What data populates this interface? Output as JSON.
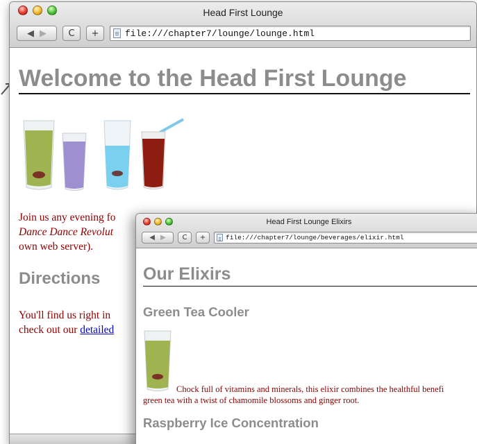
{
  "main_window": {
    "title": "Head First Lounge",
    "url": "file:///chapter7/lounge/lounge.html",
    "buttons": {
      "back": "◀",
      "forward": "▶",
      "reload": "C",
      "add": "+"
    },
    "heading": "Welcome to the Head First Lounge",
    "intro_text_1": "Join us any evening fo",
    "intro_text_2": "Dance Dance Revolut",
    "intro_text_3": "own web server).",
    "directions_heading": "Directions",
    "directions_text_1": "You'll find us right in",
    "directions_text_2": "check out our ",
    "directions_link": "detailed"
  },
  "elixir_window": {
    "title": "Head First Lounge Elixirs",
    "url": "file:///chapter7/lounge/beverages/elixir.html",
    "buttons": {
      "back": "◀",
      "forward": "▶",
      "reload": "C",
      "add": "+"
    },
    "heading": "Our Elixirs",
    "item1_title": "Green Tea Cooler",
    "item1_desc_1": "Chock full of vitamins and minerals, this elixir combines the healthful benefi",
    "item1_desc_2": "green tea with a twist of chamomile blossoms and ginger root.",
    "item2_title": "Raspberry Ice Concentration"
  },
  "icons": [
    "traffic-lights",
    "back-arrow-icon",
    "forward-arrow-icon",
    "reload-icon",
    "add-bookmark-icon",
    "page-icon",
    "drink-glass-icons"
  ],
  "colors": {
    "heading_gray": "#8c8c8c",
    "body_text": "#8b0000",
    "link": "#0000cc"
  }
}
